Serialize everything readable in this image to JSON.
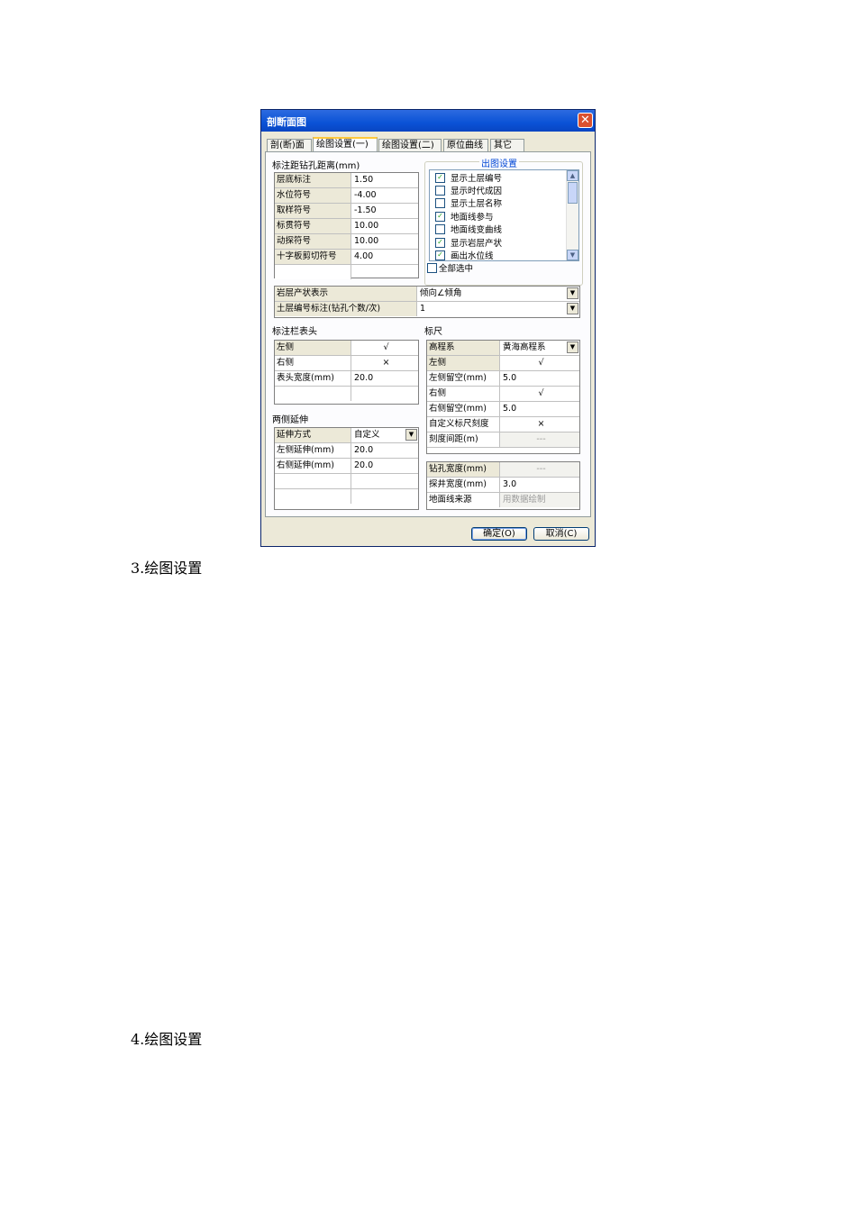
{
  "dialog": {
    "title": "剖断面图",
    "tabs": [
      "剖(断)面",
      "绘图设置(一)",
      "绘图设置(二)",
      "原位曲线",
      "其它"
    ],
    "active_tab_index": 1,
    "distance_section": {
      "title": "标注距钻孔距离(mm)",
      "rows": [
        {
          "label": "层底标注",
          "value": "1.50"
        },
        {
          "label": "水位符号",
          "value": "-4.00"
        },
        {
          "label": "取样符号",
          "value": "-1.50"
        },
        {
          "label": "标贯符号",
          "value": "10.00"
        },
        {
          "label": "动探符号",
          "value": "10.00"
        },
        {
          "label": "十字板剪切符号",
          "value": "4.00"
        }
      ]
    },
    "output_settings": {
      "title": "出图设置",
      "items": [
        {
          "label": "显示土层编号",
          "checked": true
        },
        {
          "label": "显示时代成因",
          "checked": false
        },
        {
          "label": "显示土层名称",
          "checked": false
        },
        {
          "label": "地面线参与",
          "checked": true
        },
        {
          "label": "地面线变曲线",
          "checked": false
        },
        {
          "label": "显示岩层产状",
          "checked": true
        },
        {
          "label": "画出水位线",
          "checked": true
        }
      ],
      "select_all_label": "全部选中"
    },
    "combos": [
      {
        "label": "岩层产状表示",
        "value": "倾向∠倾角"
      },
      {
        "label": "土层编号标注(钻孔个数/次)",
        "value": "1"
      }
    ],
    "header_section": {
      "title": "标注栏表头",
      "rows": [
        {
          "label": "左侧",
          "value": "√"
        },
        {
          "label": "右侧",
          "value": "×"
        },
        {
          "label": "表头宽度(mm)",
          "value": "20.0"
        }
      ]
    },
    "extend_section": {
      "title": "两侧延伸",
      "rows": [
        {
          "label": "延伸方式",
          "value": "自定义"
        },
        {
          "label": "左侧延伸(mm)",
          "value": "20.0"
        },
        {
          "label": "右侧延伸(mm)",
          "value": "20.0"
        }
      ]
    },
    "ruler_section": {
      "title": "标尺",
      "rows": [
        {
          "label": "高程系",
          "value": "黄海高程系"
        },
        {
          "label": "左侧",
          "value": "√"
        },
        {
          "label": "左侧留空(mm)",
          "value": "5.0"
        },
        {
          "label": "右侧",
          "value": "√"
        },
        {
          "label": "右侧留空(mm)",
          "value": "5.0"
        },
        {
          "label": "自定义标尺刻度",
          "value": "×"
        },
        {
          "label": "刻度间距(m)",
          "value": "---"
        }
      ]
    },
    "bore_section": {
      "rows": [
        {
          "label": "钻孔宽度(mm)",
          "value": "---"
        },
        {
          "label": "探井宽度(mm)",
          "value": "3.0"
        },
        {
          "label": "地面线来源",
          "value": "用数据绘制"
        }
      ]
    },
    "ok_label": "确定(O)",
    "cancel_label": "取消(C)"
  },
  "captions": [
    "3.绘图设置",
    "4.绘图设置"
  ]
}
